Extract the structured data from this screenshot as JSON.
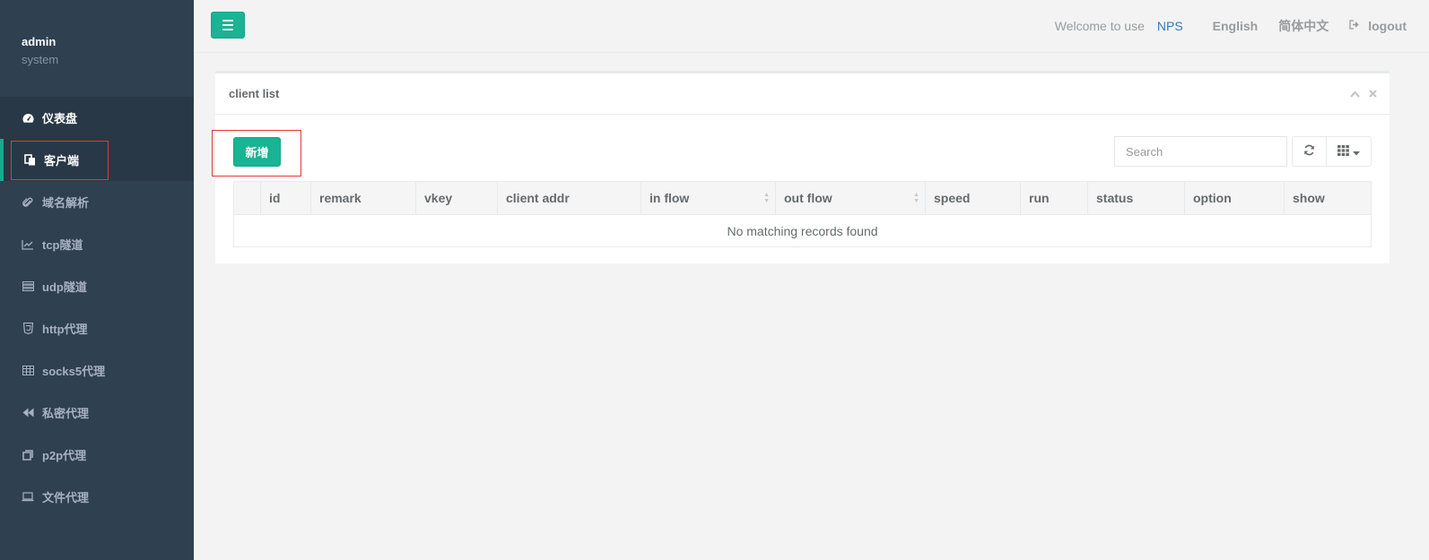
{
  "sidebar": {
    "user": "admin",
    "role": "system",
    "items": [
      {
        "label": "仪表盘",
        "icon": "dashboard-icon"
      },
      {
        "label": "客户端",
        "icon": "copy-icon"
      },
      {
        "label": "域名解析",
        "icon": "paperclip-icon"
      },
      {
        "label": "tcp隧道",
        "icon": "line-chart-icon"
      },
      {
        "label": "udp隧道",
        "icon": "list-icon"
      },
      {
        "label": "http代理",
        "icon": "html5-icon"
      },
      {
        "label": "socks5代理",
        "icon": "table-icon"
      },
      {
        "label": "私密代理",
        "icon": "backward-icon"
      },
      {
        "label": "p2p代理",
        "icon": "clone-icon"
      },
      {
        "label": "文件代理",
        "icon": "laptop-icon"
      }
    ]
  },
  "header": {
    "welcome": "Welcome to use",
    "brand": "NPS",
    "lang_en": "English",
    "lang_zh": "简体中文",
    "logout": "logout"
  },
  "panel": {
    "title": "client list",
    "add_label": "新增",
    "search_placeholder": "Search",
    "columns": [
      "",
      "id",
      "remark",
      "vkey",
      "client addr",
      "in flow",
      "out flow",
      "speed",
      "run",
      "status",
      "option",
      "show"
    ],
    "empty_message": "No matching records found"
  },
  "colors": {
    "sidebar_bg": "#2f4050",
    "accent": "#1ab394",
    "highlight_box": "#e53935"
  }
}
